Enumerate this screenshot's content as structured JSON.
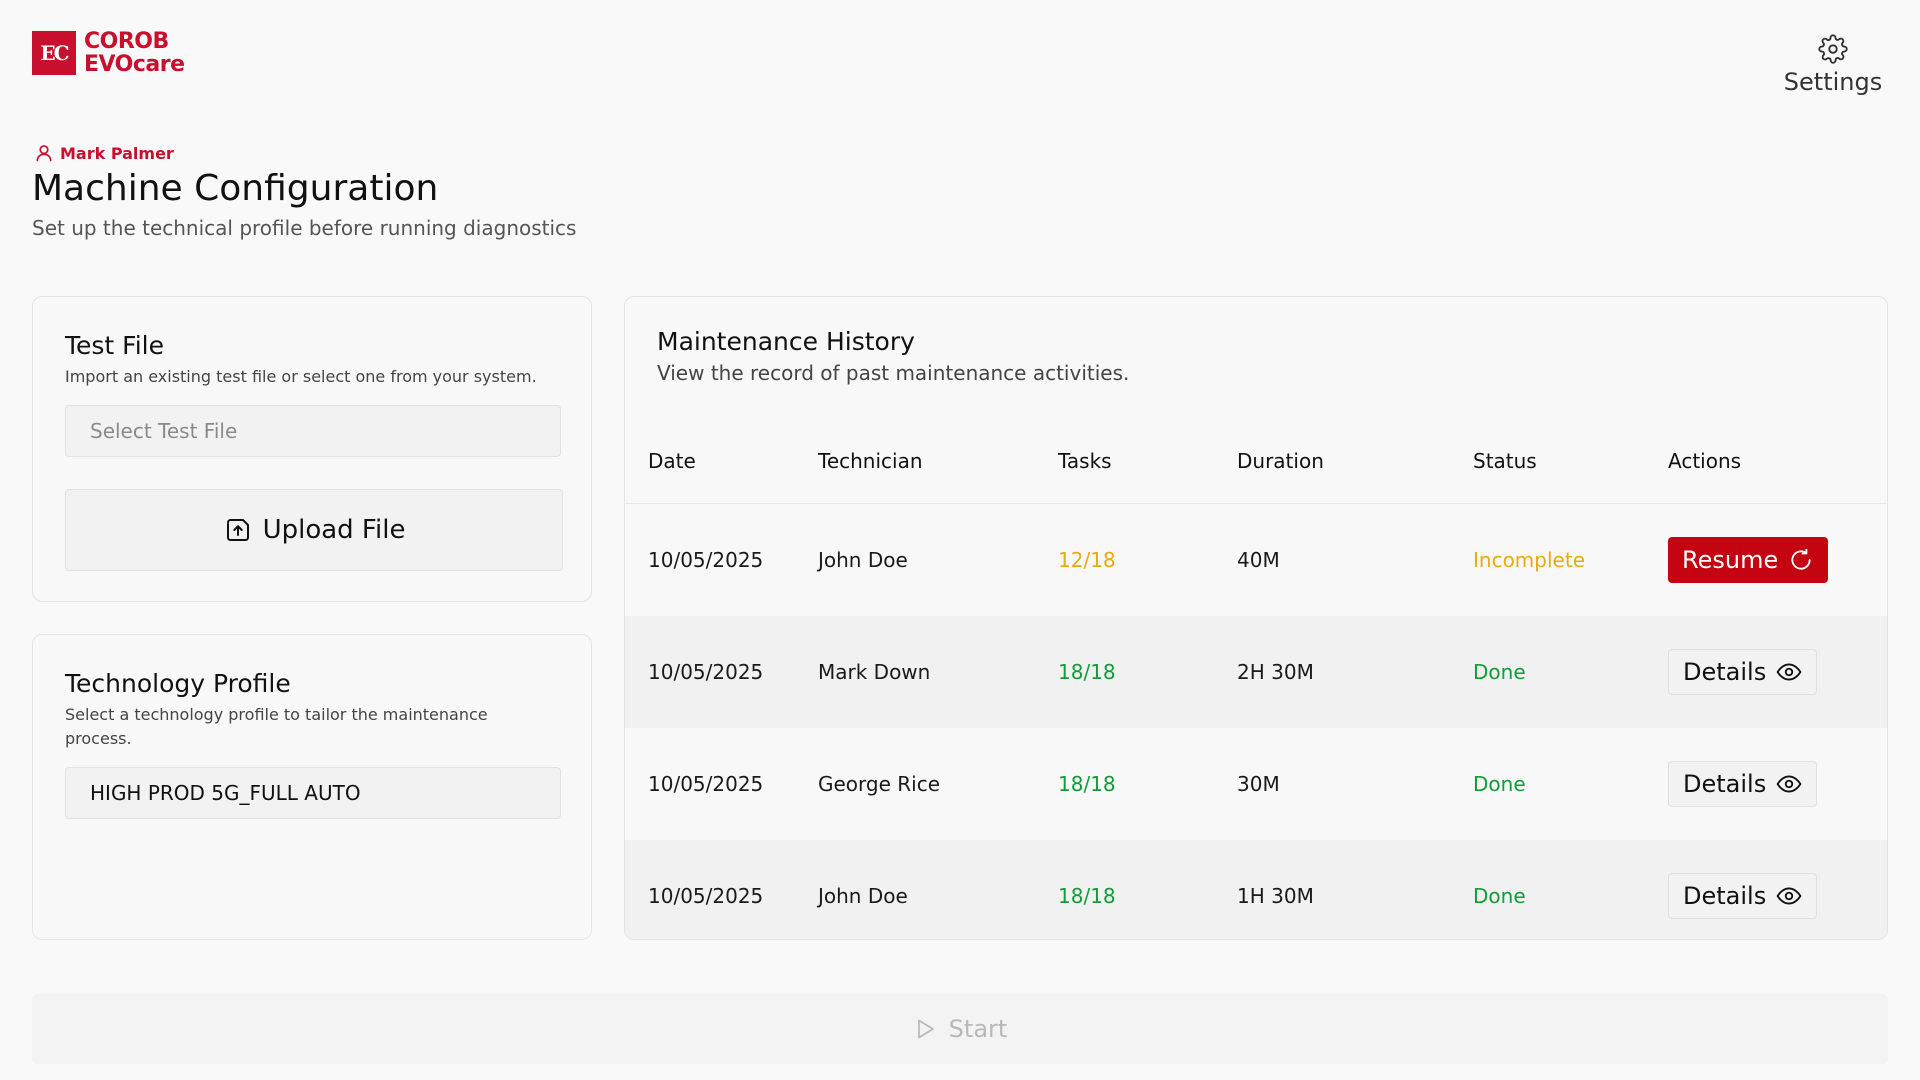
{
  "brand": {
    "mark": "EC",
    "line1": "COROB",
    "line2": "EVOcare",
    "color": "#c8102e"
  },
  "header": {
    "settings_label": "Settings",
    "settings_icon": "gear-icon"
  },
  "user": {
    "name": "Mark Palmer",
    "icon": "user-icon"
  },
  "page": {
    "title": "Machine Configuration",
    "subtitle": "Set up the technical profile before running diagnostics"
  },
  "test_file": {
    "title": "Test File",
    "description": "Import an existing test file or select one from your system.",
    "select_placeholder": "Select Test File",
    "upload_label": "Upload File",
    "upload_icon": "upload-icon"
  },
  "tech_profile": {
    "title": "Technology Profile",
    "description": "Select a technology profile to tailor the maintenance process.",
    "selected_value": "HIGH PROD 5G_FULL AUTO"
  },
  "history": {
    "title": "Maintenance History",
    "description": "View the record of past maintenance activities.",
    "columns": [
      "Date",
      "Technician",
      "Tasks",
      "Duration",
      "Status",
      "Actions"
    ],
    "rows": [
      {
        "date": "10/05/2025",
        "technician": "John Doe",
        "tasks": "12/18",
        "duration": "40M",
        "status": "Incomplete",
        "action": "Resume",
        "action_icon": "refresh-icon"
      },
      {
        "date": "10/05/2025",
        "technician": "Mark Down",
        "tasks": "18/18",
        "duration": "2H 30M",
        "status": "Done",
        "action": "Details",
        "action_icon": "eye-icon"
      },
      {
        "date": "10/05/2025",
        "technician": "George Rice",
        "tasks": "18/18",
        "duration": "30M",
        "status": "Done",
        "action": "Details",
        "action_icon": "eye-icon"
      },
      {
        "date": "10/05/2025",
        "technician": "John Doe",
        "tasks": "18/18",
        "duration": "1H 30M",
        "status": "Done",
        "action": "Details",
        "action_icon": "eye-icon"
      }
    ]
  },
  "start": {
    "label": "Start",
    "icon": "play-icon",
    "enabled": false
  },
  "colors": {
    "accent": "#c40511",
    "incomplete": "#e8aa0d",
    "done": "#119c3b"
  }
}
